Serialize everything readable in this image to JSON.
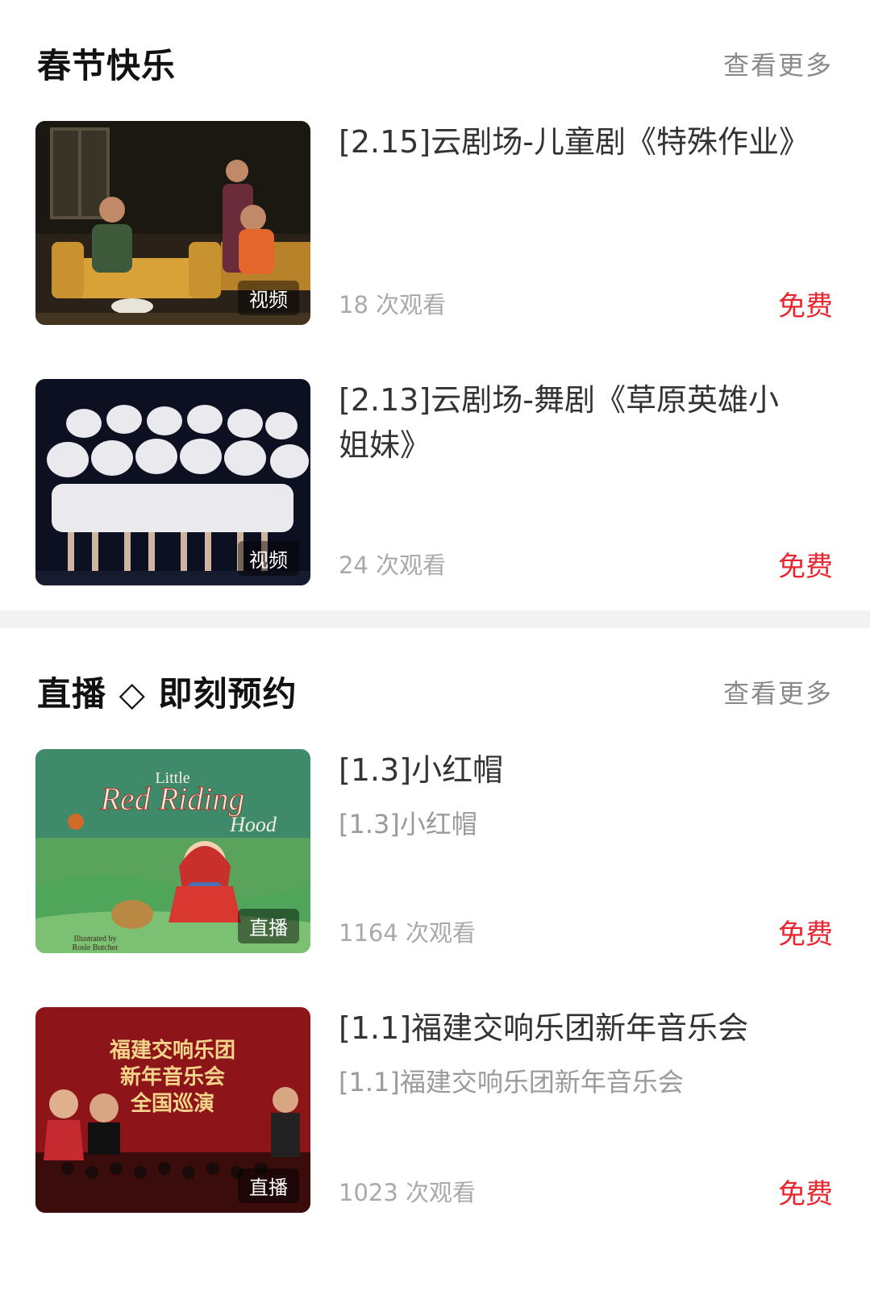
{
  "sections": [
    {
      "title": "春节快乐",
      "more": "查看更多",
      "items": [
        {
          "title": "[2.15]云剧场-儿童剧《特殊作业》",
          "subtitle": "",
          "views": "18 次观看",
          "price": "免费",
          "badge": "视频"
        },
        {
          "title": "[2.13]云剧场-舞剧《草原英雄小姐妹》",
          "subtitle": "",
          "views": "24 次观看",
          "price": "免费",
          "badge": "视频"
        }
      ]
    },
    {
      "title": "直播 ◇ 即刻预约",
      "more": "查看更多",
      "items": [
        {
          "title": "[1.3]小红帽",
          "subtitle": "[1.3]小红帽",
          "views": "1164 次观看",
          "price": "免费",
          "badge": "直播",
          "thumb_text": {
            "line1": "Little",
            "line2": "Red Riding",
            "line3": "Hood",
            "credit1": "Illustrated by",
            "credit2": "Rosie Butcher"
          }
        },
        {
          "title": "[1.1]福建交响乐团新年音乐会",
          "subtitle": "[1.1]福建交响乐团新年音乐会",
          "views": "1023 次观看",
          "price": "免费",
          "badge": "直播",
          "thumb_text": {
            "line1": "福建交响乐团",
            "line2": "新年音乐会",
            "line3": "全国巡演"
          }
        }
      ]
    }
  ],
  "colors": {
    "accent": "#e8262f",
    "muted": "#8a8a8a",
    "divider": "#f2f2f2"
  }
}
